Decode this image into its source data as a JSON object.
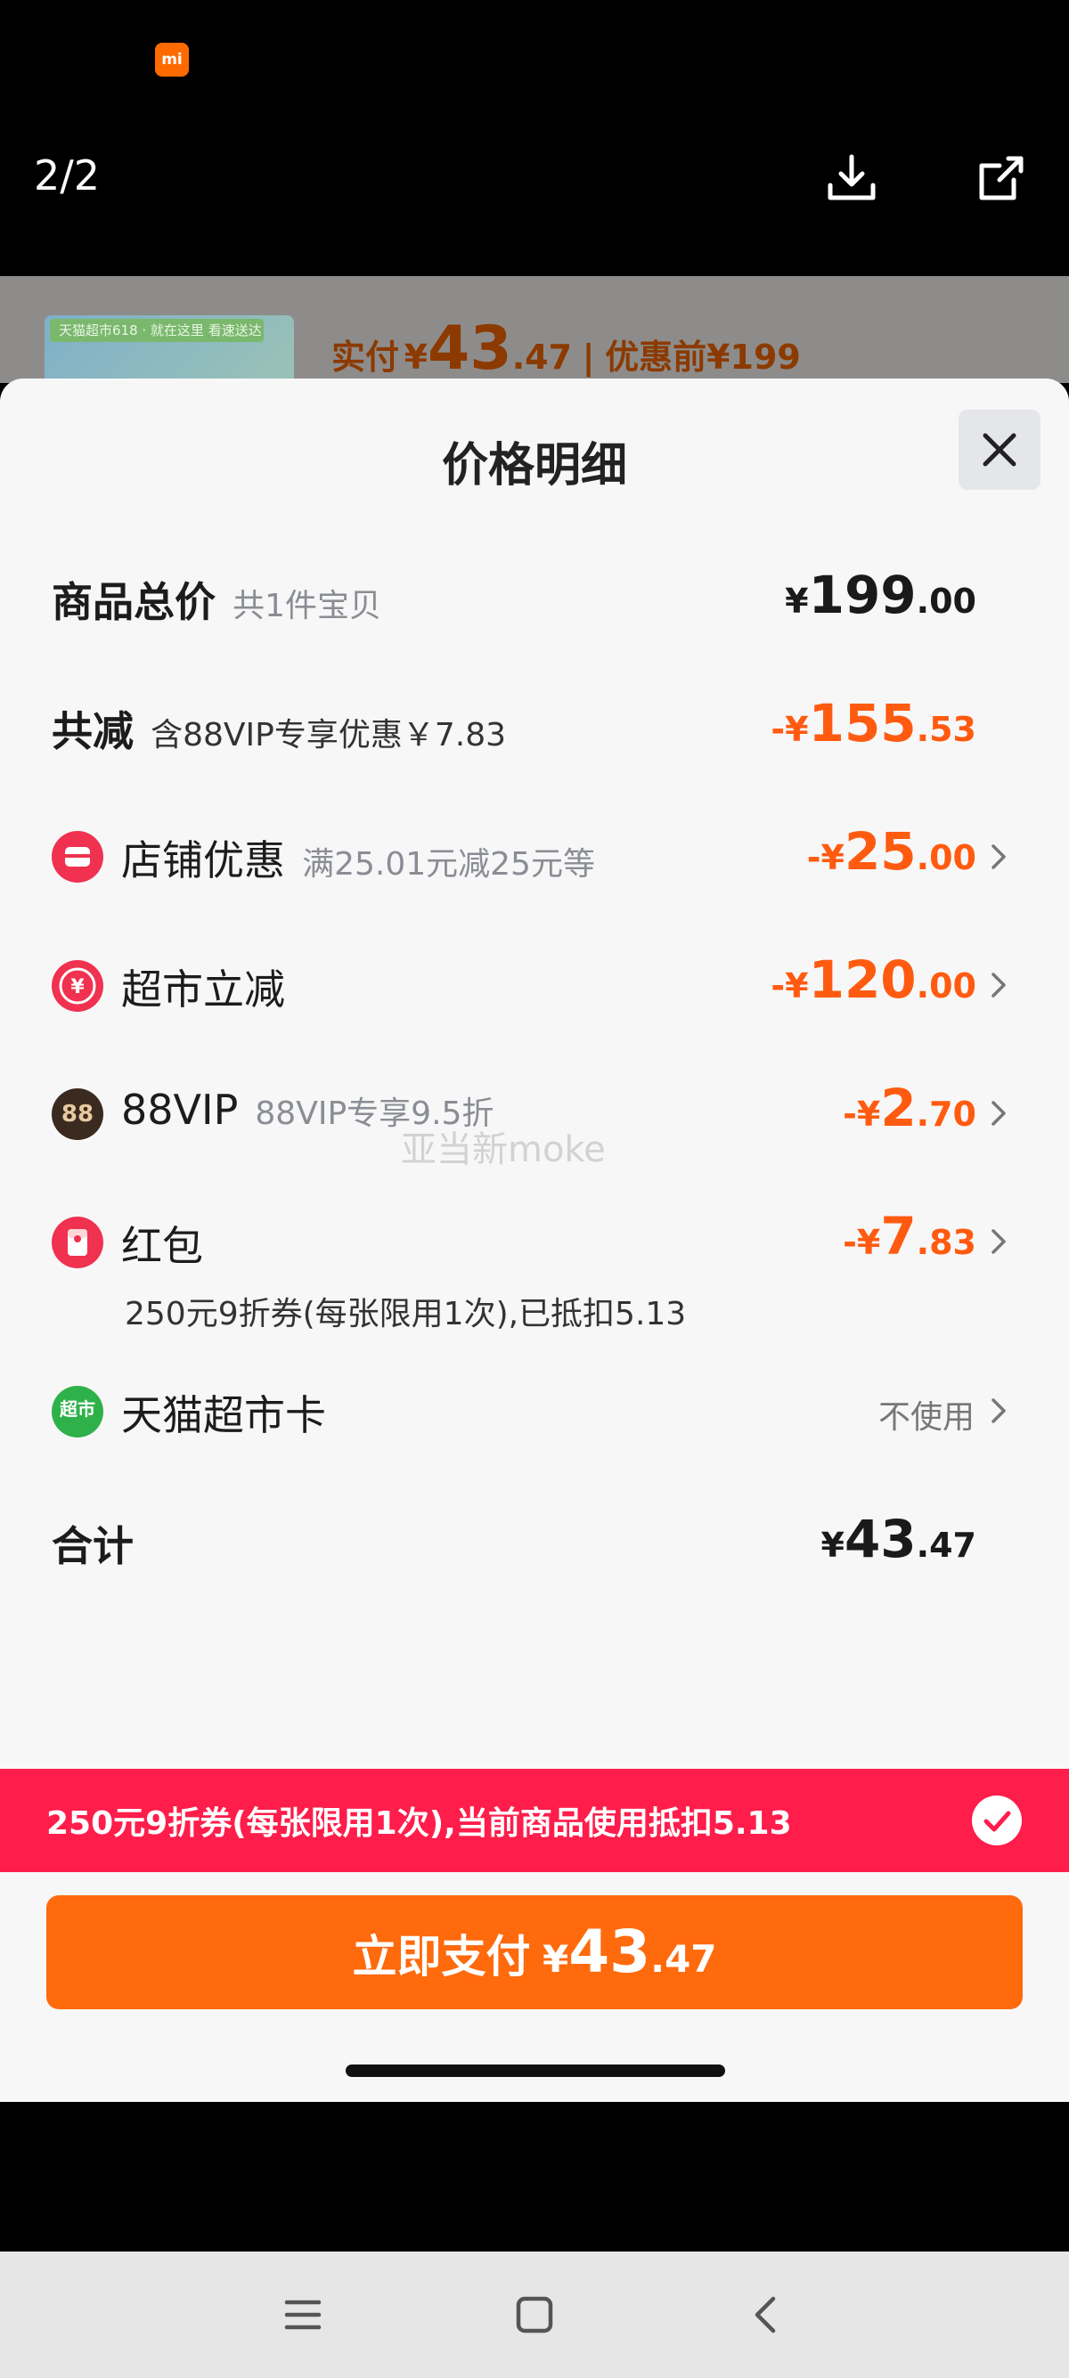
{
  "viewer": {
    "brand_badge": "mi",
    "page_counter": "2/2",
    "download_icon": "download-icon",
    "share_icon": "share-icon"
  },
  "background_card": {
    "thumb_tag": "天猫超市618 · 就在这里 看速送达",
    "paid_label": "实付",
    "paid_currency": "¥",
    "paid_int": "43",
    "paid_dec": ".47",
    "divider": "|",
    "before_label": "优惠前",
    "before_amount": "¥199"
  },
  "sheet": {
    "title": "价格明细",
    "close_icon": "close-icon"
  },
  "rows": {
    "total": {
      "label": "商品总价",
      "sub": "共1件宝贝",
      "cur": "¥",
      "int": "199",
      "dec": ".00"
    },
    "reduce": {
      "label": "共减",
      "sub": "含88VIP专享优惠￥7.83",
      "cur": "-¥",
      "int": "155",
      "dec": ".53"
    },
    "shop": {
      "label": "店铺优惠",
      "sub": "满25.01元减25元等",
      "cur": "-¥",
      "int": "25",
      "dec": ".00"
    },
    "market": {
      "label": "超市立减",
      "cur": "-¥",
      "int": "120",
      "dec": ".00"
    },
    "vip": {
      "label": "88VIP",
      "icon_text": "88",
      "sub": "88VIP专享9.5折",
      "cur": "-¥",
      "int": "2",
      "dec": ".70"
    },
    "redpack": {
      "label": "红包",
      "cur": "-¥",
      "int": "7",
      "dec": ".83",
      "note": "250元9折券(每张限用1次),已抵扣5.13"
    },
    "card": {
      "label": "天猫超市卡",
      "icon_text": "超市",
      "status": "不使用"
    },
    "sum": {
      "label": "合计",
      "cur": "¥",
      "int": "43",
      "dec": ".47"
    }
  },
  "watermark": "亚当新moke",
  "banner": {
    "text": "250元9折券(每张限用1次),当前商品使用抵扣5.13"
  },
  "pay_button": {
    "label": "立即支付",
    "cur": "¥",
    "int": "43",
    "dec": ".47"
  },
  "navbar": {
    "menu_icon": "menu-icon",
    "home_icon": "home-icon",
    "back_icon": "back-icon"
  },
  "colors": {
    "accent_orange": "#ff5b10",
    "banner_red": "#fe1d4b",
    "pay_button": "#ff6a0d"
  }
}
